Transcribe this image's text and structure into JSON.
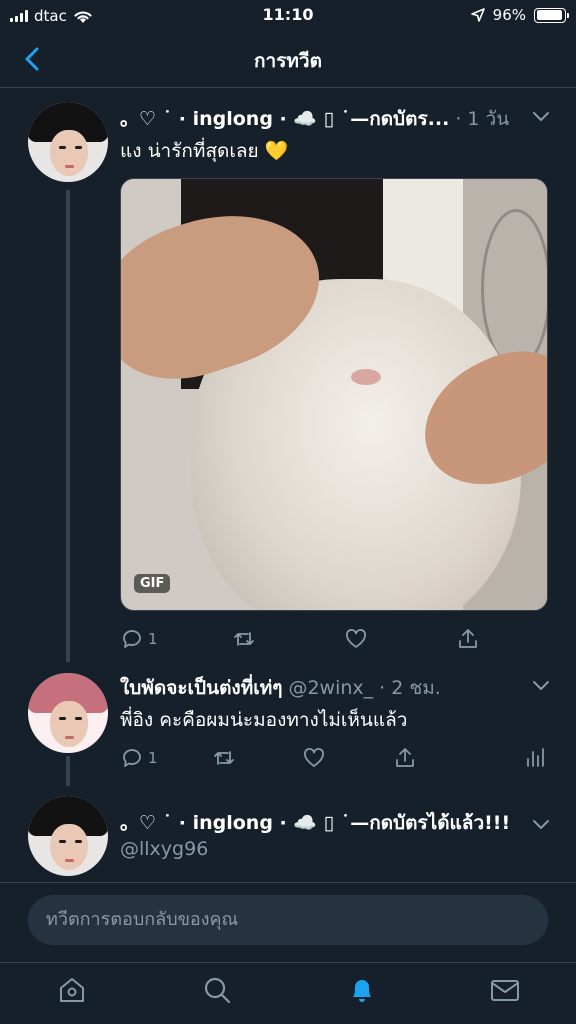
{
  "status_bar": {
    "carrier": "dtac",
    "time": "11:10",
    "battery": "96%"
  },
  "header": {
    "title": "การทวีต"
  },
  "tweets": [
    {
      "display_name": "。♡ ˙ · inglong · ☁️ ▯ ˙—กดบัตร...",
      "time": "· 1 วัน",
      "text": "แง น่ารักที่สุดเลย 💛",
      "media_badge": "GIF",
      "reply_count": "1"
    },
    {
      "display_name": "ใบพัดจะเป็นต่งที่เท่ๆ",
      "handle": "@2winx_",
      "time": "· 2 ชม.",
      "text": "พี่อิง คะคือผมน่ะมองทางไม่เห็นแล้ว",
      "reply_count": "1"
    },
    {
      "display_name": "。♡ ˙ · inglong · ☁️ ▯ ˙—กดบัตรได้แล้ว!!!",
      "handle": "@llxyg96"
    }
  ],
  "reply": {
    "placeholder": "ทวีตการตอบกลับของคุณ"
  },
  "colors": {
    "background": "#15202b",
    "accent": "#1da1f2",
    "secondary_text": "#8899a6",
    "divider": "#38444d"
  },
  "icons": {
    "home": "home-icon",
    "search": "search-icon",
    "notifications": "bell-icon",
    "messages": "mail-icon"
  }
}
